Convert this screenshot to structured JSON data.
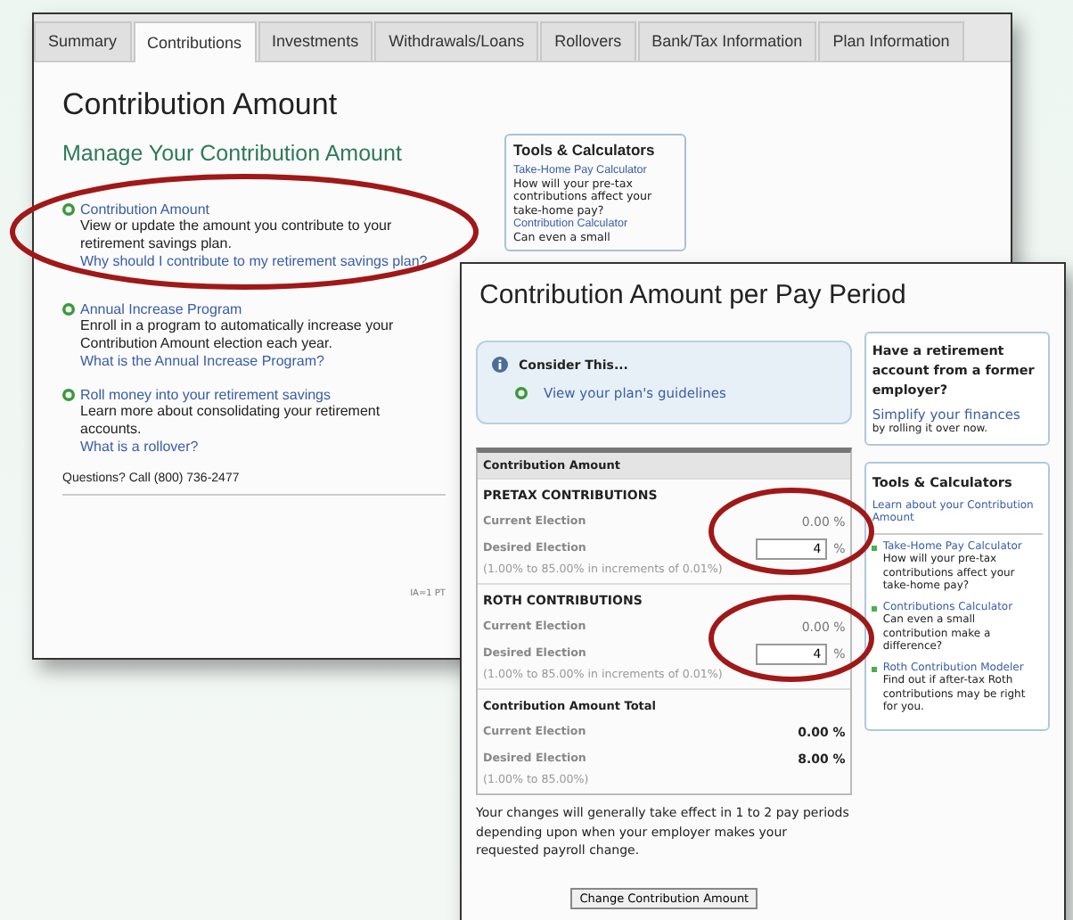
{
  "back_window": {
    "tabs": [
      {
        "label": "Summary",
        "selected": false
      },
      {
        "label": "Contributions",
        "selected": true
      },
      {
        "label": "Investments",
        "selected": false
      },
      {
        "label": "Withdrawals/Loans",
        "selected": false
      },
      {
        "label": "Rollovers",
        "selected": false
      },
      {
        "label": "Bank/Tax Information",
        "selected": false
      },
      {
        "label": "Plan Information",
        "selected": false
      }
    ],
    "title": "Contribution Amount",
    "heading": "Manage Your Contribution Amount",
    "items": [
      {
        "link": "Contribution Amount",
        "description": "View or update the amount you contribute to your retirement savings plan.",
        "help_link": "Why should I contribute to my retirement savings plan?"
      },
      {
        "link": "Annual Increase Program",
        "description": "Enroll in a program to automatically increase your Contribution Amount election each year.",
        "help_link": "What is the Annual Increase Program?"
      },
      {
        "link": "Roll money into your retirement savings",
        "description": "Learn more about consolidating your retirement accounts.",
        "help_link": "What is a rollover?"
      }
    ],
    "tools": {
      "title": "Tools & Calculators",
      "items": [
        {
          "link": "Take-Home Pay Calculator",
          "description": "How will your pre-tax contributions affect your take-home pay?"
        },
        {
          "link": "Contribution Calculator",
          "description": "Can even a small"
        }
      ]
    },
    "questions": "Questions?  Call (800) 736-2477",
    "footer_code": "IA=1 PT"
  },
  "front_window": {
    "title": "Contribution Amount per Pay Period",
    "consider": {
      "title": "Consider This...",
      "link": "View your plan's guidelines"
    },
    "contribution_box": {
      "header": "Contribution Amount",
      "sections": [
        {
          "kind": "group",
          "title": "PRETAX CONTRIBUTIONS",
          "rows": [
            {
              "kind": "reading",
              "label": "Current Election",
              "value": "0.00 %"
            },
            {
              "kind": "input",
              "label": "Desired Election",
              "value": "4",
              "unit": "%"
            }
          ],
          "note": "(1.00% to 85.00% in increments of 0.01%)"
        },
        {
          "kind": "group",
          "title": "ROTH CONTRIBUTIONS",
          "rows": [
            {
              "kind": "reading",
              "label": "Current Election",
              "value": "0.00 %"
            },
            {
              "kind": "input",
              "label": "Desired Election",
              "value": "4",
              "unit": "%"
            }
          ],
          "note": "(1.00% to 85.00% in increments of 0.01%)"
        },
        {
          "kind": "total",
          "title": "Contribution Amount Total",
          "rows": [
            {
              "kind": "reading",
              "label": "Current Election",
              "value": "0.00 %"
            },
            {
              "kind": "reading",
              "label": "Desired Election",
              "value": "8.00 %"
            }
          ],
          "note": "(1.00% to 85.00%)"
        }
      ]
    },
    "note": "Your changes will generally take effect in 1 to 2 pay periods depending upon when your employer makes your requested payroll change.",
    "button": "Change Contribution Amount",
    "rollover_box": {
      "title": "Have a retirement account from a former employer?",
      "link": "Simplify your finances",
      "text": "by rolling it over now."
    },
    "tools": {
      "title": "Tools & Calculators",
      "link": "Learn about your Contribution Amount",
      "items": [
        {
          "link": "Take-Home Pay Calculator",
          "description": "How will your pre-tax contributions affect your take-home pay?"
        },
        {
          "link": "Contributions Calculator",
          "description": "Can even a small contribution make a difference?"
        },
        {
          "link": "Roth Contribution Modeler",
          "description": "Find out if after-tax Roth contributions may be right for you."
        }
      ]
    }
  }
}
